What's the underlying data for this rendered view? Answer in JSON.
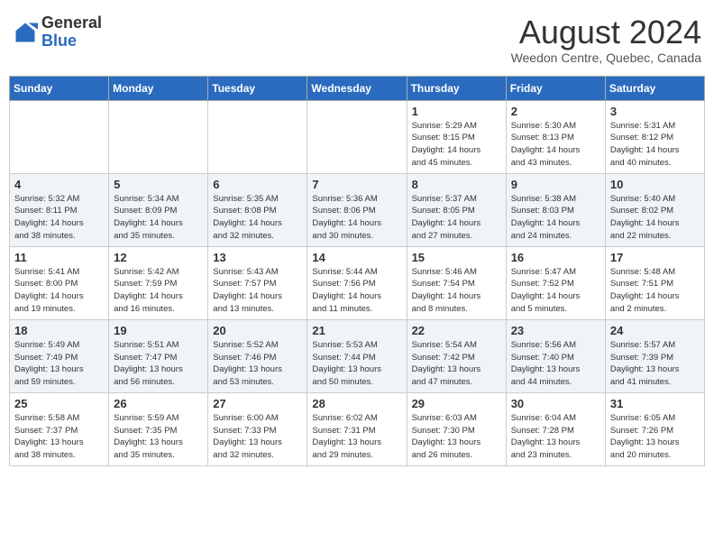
{
  "logo": {
    "general": "General",
    "blue": "Blue"
  },
  "header": {
    "title": "August 2024",
    "subtitle": "Weedon Centre, Quebec, Canada"
  },
  "days_of_week": [
    "Sunday",
    "Monday",
    "Tuesday",
    "Wednesday",
    "Thursday",
    "Friday",
    "Saturday"
  ],
  "weeks": [
    [
      {
        "day": "",
        "info": ""
      },
      {
        "day": "",
        "info": ""
      },
      {
        "day": "",
        "info": ""
      },
      {
        "day": "",
        "info": ""
      },
      {
        "day": "1",
        "info": "Sunrise: 5:29 AM\nSunset: 8:15 PM\nDaylight: 14 hours\nand 45 minutes."
      },
      {
        "day": "2",
        "info": "Sunrise: 5:30 AM\nSunset: 8:13 PM\nDaylight: 14 hours\nand 43 minutes."
      },
      {
        "day": "3",
        "info": "Sunrise: 5:31 AM\nSunset: 8:12 PM\nDaylight: 14 hours\nand 40 minutes."
      }
    ],
    [
      {
        "day": "4",
        "info": "Sunrise: 5:32 AM\nSunset: 8:11 PM\nDaylight: 14 hours\nand 38 minutes."
      },
      {
        "day": "5",
        "info": "Sunrise: 5:34 AM\nSunset: 8:09 PM\nDaylight: 14 hours\nand 35 minutes."
      },
      {
        "day": "6",
        "info": "Sunrise: 5:35 AM\nSunset: 8:08 PM\nDaylight: 14 hours\nand 32 minutes."
      },
      {
        "day": "7",
        "info": "Sunrise: 5:36 AM\nSunset: 8:06 PM\nDaylight: 14 hours\nand 30 minutes."
      },
      {
        "day": "8",
        "info": "Sunrise: 5:37 AM\nSunset: 8:05 PM\nDaylight: 14 hours\nand 27 minutes."
      },
      {
        "day": "9",
        "info": "Sunrise: 5:38 AM\nSunset: 8:03 PM\nDaylight: 14 hours\nand 24 minutes."
      },
      {
        "day": "10",
        "info": "Sunrise: 5:40 AM\nSunset: 8:02 PM\nDaylight: 14 hours\nand 22 minutes."
      }
    ],
    [
      {
        "day": "11",
        "info": "Sunrise: 5:41 AM\nSunset: 8:00 PM\nDaylight: 14 hours\nand 19 minutes."
      },
      {
        "day": "12",
        "info": "Sunrise: 5:42 AM\nSunset: 7:59 PM\nDaylight: 14 hours\nand 16 minutes."
      },
      {
        "day": "13",
        "info": "Sunrise: 5:43 AM\nSunset: 7:57 PM\nDaylight: 14 hours\nand 13 minutes."
      },
      {
        "day": "14",
        "info": "Sunrise: 5:44 AM\nSunset: 7:56 PM\nDaylight: 14 hours\nand 11 minutes."
      },
      {
        "day": "15",
        "info": "Sunrise: 5:46 AM\nSunset: 7:54 PM\nDaylight: 14 hours\nand 8 minutes."
      },
      {
        "day": "16",
        "info": "Sunrise: 5:47 AM\nSunset: 7:52 PM\nDaylight: 14 hours\nand 5 minutes."
      },
      {
        "day": "17",
        "info": "Sunrise: 5:48 AM\nSunset: 7:51 PM\nDaylight: 14 hours\nand 2 minutes."
      }
    ],
    [
      {
        "day": "18",
        "info": "Sunrise: 5:49 AM\nSunset: 7:49 PM\nDaylight: 13 hours\nand 59 minutes."
      },
      {
        "day": "19",
        "info": "Sunrise: 5:51 AM\nSunset: 7:47 PM\nDaylight: 13 hours\nand 56 minutes."
      },
      {
        "day": "20",
        "info": "Sunrise: 5:52 AM\nSunset: 7:46 PM\nDaylight: 13 hours\nand 53 minutes."
      },
      {
        "day": "21",
        "info": "Sunrise: 5:53 AM\nSunset: 7:44 PM\nDaylight: 13 hours\nand 50 minutes."
      },
      {
        "day": "22",
        "info": "Sunrise: 5:54 AM\nSunset: 7:42 PM\nDaylight: 13 hours\nand 47 minutes."
      },
      {
        "day": "23",
        "info": "Sunrise: 5:56 AM\nSunset: 7:40 PM\nDaylight: 13 hours\nand 44 minutes."
      },
      {
        "day": "24",
        "info": "Sunrise: 5:57 AM\nSunset: 7:39 PM\nDaylight: 13 hours\nand 41 minutes."
      }
    ],
    [
      {
        "day": "25",
        "info": "Sunrise: 5:58 AM\nSunset: 7:37 PM\nDaylight: 13 hours\nand 38 minutes."
      },
      {
        "day": "26",
        "info": "Sunrise: 5:59 AM\nSunset: 7:35 PM\nDaylight: 13 hours\nand 35 minutes."
      },
      {
        "day": "27",
        "info": "Sunrise: 6:00 AM\nSunset: 7:33 PM\nDaylight: 13 hours\nand 32 minutes."
      },
      {
        "day": "28",
        "info": "Sunrise: 6:02 AM\nSunset: 7:31 PM\nDaylight: 13 hours\nand 29 minutes."
      },
      {
        "day": "29",
        "info": "Sunrise: 6:03 AM\nSunset: 7:30 PM\nDaylight: 13 hours\nand 26 minutes."
      },
      {
        "day": "30",
        "info": "Sunrise: 6:04 AM\nSunset: 7:28 PM\nDaylight: 13 hours\nand 23 minutes."
      },
      {
        "day": "31",
        "info": "Sunrise: 6:05 AM\nSunset: 7:26 PM\nDaylight: 13 hours\nand 20 minutes."
      }
    ]
  ]
}
